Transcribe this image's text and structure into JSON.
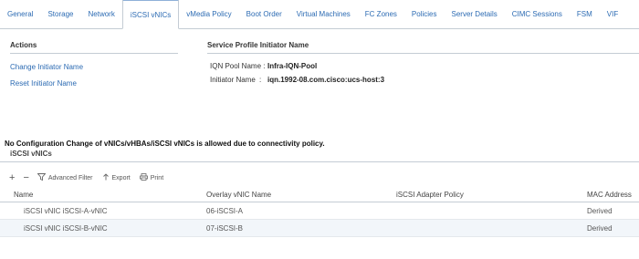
{
  "tabs": [
    {
      "label": "General",
      "active": false
    },
    {
      "label": "Storage",
      "active": false
    },
    {
      "label": "Network",
      "active": false
    },
    {
      "label": "iSCSI vNICs",
      "active": true
    },
    {
      "label": "vMedia Policy",
      "active": false
    },
    {
      "label": "Boot Order",
      "active": false
    },
    {
      "label": "Virtual Machines",
      "active": false
    },
    {
      "label": "FC Zones",
      "active": false
    },
    {
      "label": "Policies",
      "active": false
    },
    {
      "label": "Server Details",
      "active": false
    },
    {
      "label": "CIMC Sessions",
      "active": false
    },
    {
      "label": "FSM",
      "active": false
    },
    {
      "label": "VIF",
      "active": false
    }
  ],
  "actions": {
    "header": "Actions",
    "items": [
      "Change Initiator Name",
      "Reset Initiator Name"
    ]
  },
  "initiator": {
    "header": "Service Profile Initiator Name",
    "iqn_pool_label": "IQN Pool Name :",
    "iqn_pool_value": "Infra-IQN-Pool",
    "initiator_label": "Initiator Name",
    "initiator_sep": ":",
    "initiator_value": "iqn.1992-08.com.cisco:ucs-host:3"
  },
  "notice": "No Configuration Change of vNICs/vHBAs/iSCSI vNICs is allowed due to connectivity policy.",
  "grid": {
    "title": "iSCSI vNICs",
    "toolbar": {
      "add": "+",
      "remove": "−",
      "filter": "Advanced Filter",
      "export": "Export",
      "print": "Print"
    },
    "columns": [
      "Name",
      "Overlay vNIC Name",
      "iSCSI Adapter Policy",
      "MAC Address"
    ],
    "rows": [
      {
        "name": "iSCSI vNIC iSCSI-A-vNIC",
        "overlay": "06-iSCSI-A",
        "policy": "",
        "mac": "Derived"
      },
      {
        "name": "iSCSI vNIC iSCSI-B-vNIC",
        "overlay": "07-iSCSI-B",
        "policy": "",
        "mac": "Derived"
      }
    ]
  },
  "colors": {
    "link": "#2c6bb3",
    "border": "#c4ccd4",
    "row_alt": "#f2f6fa"
  }
}
